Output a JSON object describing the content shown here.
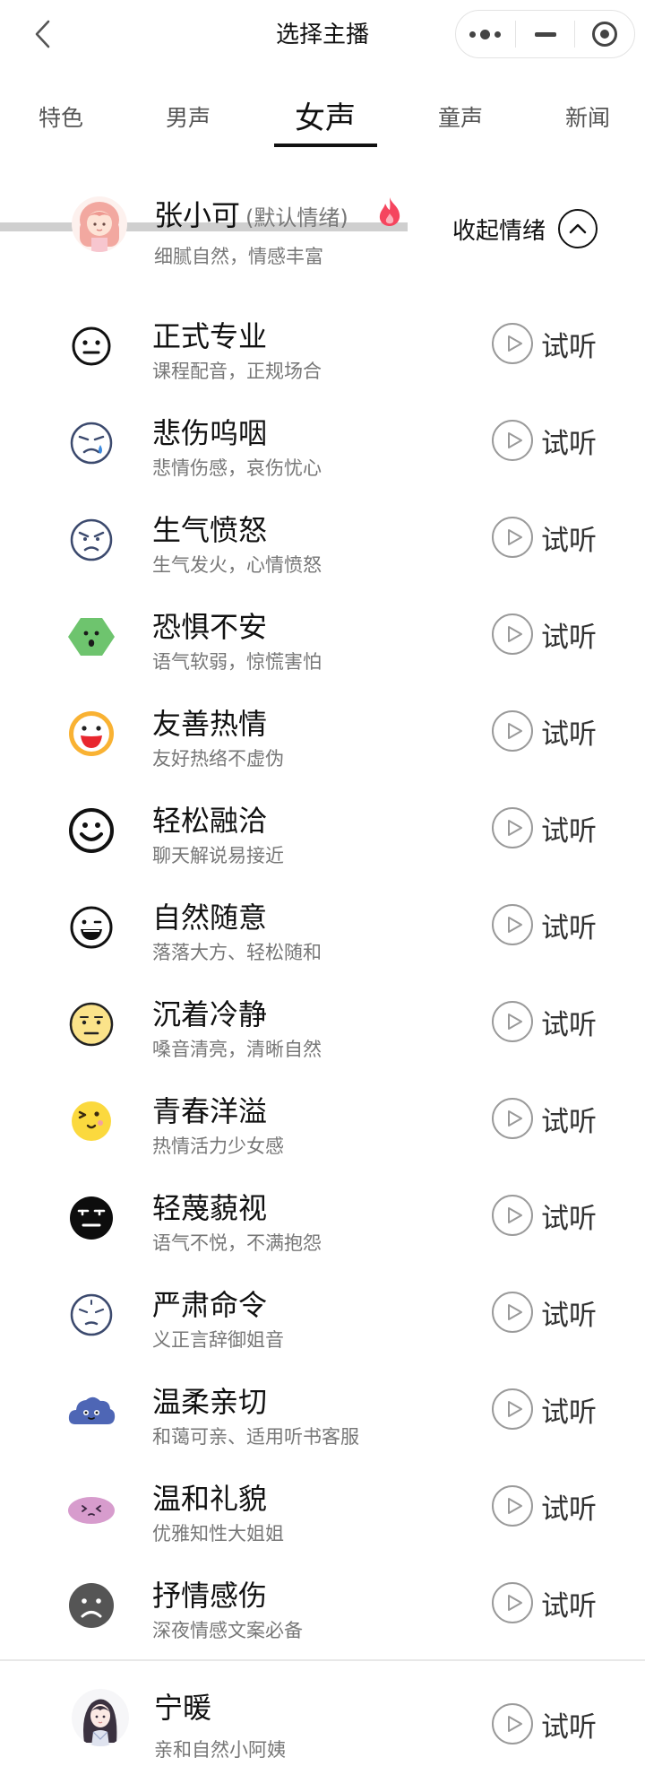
{
  "header": {
    "title": "选择主播",
    "back_icon": "chevron-left-icon",
    "menu_icon": "more-dots-icon",
    "minimize_icon": "minus-icon",
    "close_icon": "target-icon"
  },
  "tabs": [
    {
      "label": "特色"
    },
    {
      "label": "男声"
    },
    {
      "label": "女声",
      "active": true
    },
    {
      "label": "童声"
    },
    {
      "label": "新闻"
    }
  ],
  "default_voice": {
    "name": "张小可",
    "note": "(默认情绪)",
    "desc": "细腻自然，情感丰富",
    "hot_icon": "flame-icon",
    "hot_color": "#f5455e",
    "collapse_label": "收起情绪",
    "collapse_icon": "chevron-up-icon"
  },
  "listen_label": "试听",
  "emotions": [
    {
      "name": "正式专业",
      "desc": "课程配音，正规场合",
      "icon": "neutral-face-icon"
    },
    {
      "name": "悲伤呜咽",
      "desc": "悲情伤感，哀伤忧心",
      "icon": "crying-face-icon"
    },
    {
      "name": "生气愤怒",
      "desc": "生气发火，心情愤怒",
      "icon": "angry-face-icon"
    },
    {
      "name": "恐惧不安",
      "desc": "语气软弱，惊慌害怕",
      "icon": "scared-hexagon-face-icon"
    },
    {
      "name": "友善热情",
      "desc": "友好热络不虚伪",
      "icon": "laughing-face-icon"
    },
    {
      "name": "轻松融洽",
      "desc": "聊天解说易接近",
      "icon": "smiling-face-icon"
    },
    {
      "name": "自然随意",
      "desc": "落落大方、轻松随和",
      "icon": "grinning-face-icon"
    },
    {
      "name": "沉着冷静",
      "desc": "嗓音清亮，清晰自然",
      "icon": "calm-face-icon"
    },
    {
      "name": "青春洋溢",
      "desc": "热情活力少女感",
      "icon": "winking-face-icon"
    },
    {
      "name": "轻蔑藐视",
      "desc": "语气不悦，不满抱怨",
      "icon": "contempt-face-icon"
    },
    {
      "name": "严肃命令",
      "desc": "义正言辞御姐音",
      "icon": "serious-face-icon"
    },
    {
      "name": "温柔亲切",
      "desc": "和蔼可亲、适用听书客服",
      "icon": "cloud-face-icon"
    },
    {
      "name": "温和礼貌",
      "desc": "优雅知性大姐姐",
      "icon": "shy-blob-face-icon"
    },
    {
      "name": "抒情感伤",
      "desc": "深夜情感文案必备",
      "icon": "sad-face-icon"
    }
  ],
  "next_voice": {
    "name": "宁暖",
    "desc": "亲和自然小阿姨"
  },
  "colors": {
    "active_tab_underline": "#111111",
    "play_circle": "#9a9a9a",
    "secondary_text": "#777777"
  }
}
